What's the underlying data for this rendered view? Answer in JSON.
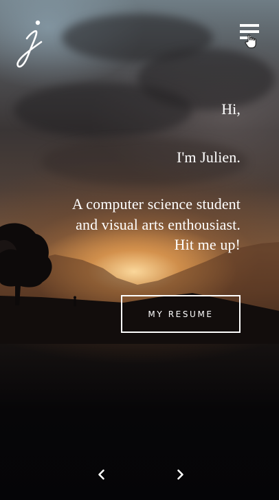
{
  "header": {
    "logo_icon": "j-script-logo-icon",
    "menu_icon": "hamburger-menu-icon"
  },
  "hero": {
    "greeting": "Hi,",
    "intro": "I'm Julien.",
    "tagline_line1": "A computer science student",
    "tagline_line2": "and visual arts enthousiast.",
    "tagline_line3": "Hit me up!"
  },
  "cta": {
    "resume_label": "MY RESUME"
  },
  "pagination": {
    "prev_icon": "chevron-left-icon",
    "next_icon": "chevron-right-icon"
  },
  "colors": {
    "text": "#ffffff",
    "sun_glow": "#f0c080",
    "ground": "#050507"
  }
}
